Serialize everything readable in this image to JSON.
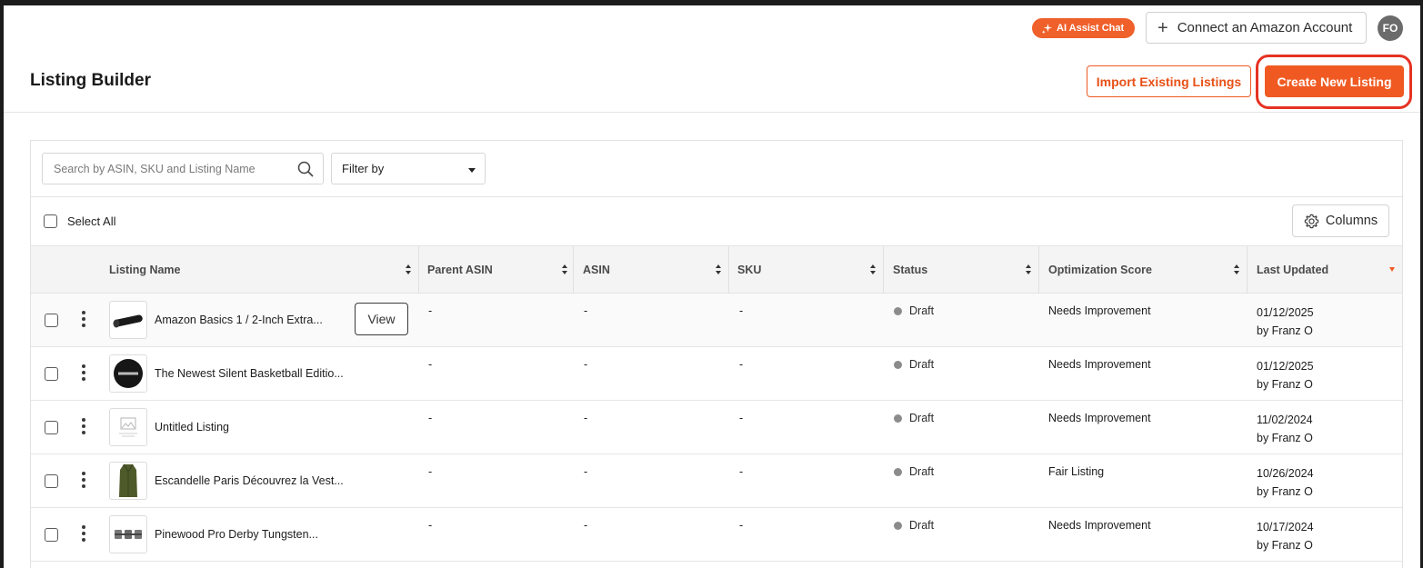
{
  "topbar": {
    "ai_chat_label": "AI Assist Chat",
    "connect_label": "Connect an Amazon Account",
    "avatar_initials": "FO"
  },
  "header": {
    "title": "Listing Builder",
    "import_label": "Import Existing Listings",
    "create_label": "Create New Listing"
  },
  "toolbar": {
    "search_placeholder": "Search by ASIN, SKU and Listing Name",
    "filter_label": "Filter by",
    "select_all_label": "Select All",
    "columns_label": "Columns"
  },
  "table": {
    "headers": {
      "listing_name": "Listing Name",
      "parent_asin": "Parent ASIN",
      "asin": "ASIN",
      "sku": "SKU",
      "status": "Status",
      "optimization_score": "Optimization Score",
      "last_updated": "Last Updated"
    },
    "view_label": "View",
    "rows": [
      {
        "name": "Amazon Basics 1 / 2-Inch Extra...",
        "parent_asin": "-",
        "asin": "-",
        "sku": "-",
        "status": "Draft",
        "score": "Needs Improvement",
        "date": "01/12/2025",
        "by": "by Franz O",
        "thumb": "mat"
      },
      {
        "name": "The Newest Silent Basketball Editio...",
        "parent_asin": "-",
        "asin": "-",
        "sku": "-",
        "status": "Draft",
        "score": "Needs Improvement",
        "date": "01/12/2025",
        "by": "by Franz O",
        "thumb": "ball"
      },
      {
        "name": "Untitled Listing",
        "parent_asin": "-",
        "asin": "-",
        "sku": "-",
        "status": "Draft",
        "score": "Needs Improvement",
        "date": "11/02/2024",
        "by": "by Franz O",
        "thumb": "placeholder"
      },
      {
        "name": "Escandelle Paris Découvrez la Vest...",
        "parent_asin": "-",
        "asin": "-",
        "sku": "-",
        "status": "Draft",
        "score": "Fair Listing",
        "date": "10/26/2024",
        "by": "by Franz O",
        "thumb": "coat"
      },
      {
        "name": "Pinewood Pro Derby Tungsten...",
        "parent_asin": "-",
        "asin": "-",
        "sku": "-",
        "status": "Draft",
        "score": "Needs Improvement",
        "date": "10/17/2024",
        "by": "by Franz O",
        "thumb": "weights"
      }
    ]
  },
  "colors": {
    "accent": "#f05a22",
    "highlight_ring": "#e63222",
    "status_dot": "#8b8b8b"
  }
}
